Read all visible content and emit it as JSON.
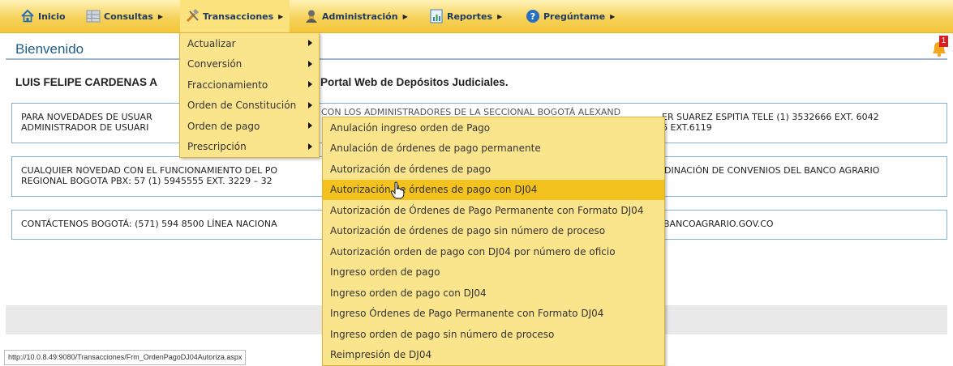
{
  "menu": {
    "items": [
      {
        "label": "Inicio",
        "icon": "home-icon",
        "has_submenu": false
      },
      {
        "label": "Consultas",
        "icon": "grid-icon",
        "has_submenu": true
      },
      {
        "label": "Transacciones",
        "icon": "tools-icon",
        "has_submenu": true
      },
      {
        "label": "Administración",
        "icon": "user-icon",
        "has_submenu": true
      },
      {
        "label": "Reportes",
        "icon": "report-icon",
        "has_submenu": true
      },
      {
        "label": "Pregúntame",
        "icon": "help-icon",
        "has_submenu": true
      }
    ]
  },
  "header": {
    "welcome": "Bienvenido",
    "notifications_count": "1",
    "user_name": "LUIS FELIPE CARDENAS A",
    "portal_text": "Portal Web de Depósitos Judiciales."
  },
  "info_boxes": [
    {
      "line1": "PARA NOVEDADES DE USUAR",
      "line2": "ADMINISTRADOR DE USUARI",
      "right1": "ER SUAREZ ESPITIA TELE (1) 3532666 EXT. 6042",
      "right2": "6 EXT.6119",
      "overlap": "CON LOS ADMINISTRADORES DE LA SECCIONAL BOGOTÁ ALEXAND"
    },
    {
      "line1": "CUALQUIER NOVEDAD CON EL FUNCIONAMIENTO DEL PO",
      "line2": "REGIONAL BOGOTA PBX: 57 (1) 5945555 EXT. 3229 – 32",
      "right1": "DINACIÓN DE CONVENIOS DEL BANCO AGRARIO",
      "right2": ""
    },
    {
      "line1": "CONTÁCTENOS BOGOTÁ: (571) 594 8500 LÍNEA NACIONA",
      "line2": "",
      "right1": "BANCOAGRARIO.GOV.CO",
      "right2": ""
    }
  ],
  "transacciones_menu": [
    {
      "label": "Actualizar",
      "submenu": true
    },
    {
      "label": "Conversión",
      "submenu": true
    },
    {
      "label": "Fraccionamiento",
      "submenu": true
    },
    {
      "label": "Orden de Constitución",
      "submenu": true
    },
    {
      "label": "Orden de pago",
      "submenu": true
    },
    {
      "label": "Prescripción",
      "submenu": true
    }
  ],
  "orden_pago_menu": [
    {
      "label": "Anulación ingreso orden de Pago"
    },
    {
      "label": "Anulación de órdenes de pago permanente"
    },
    {
      "label": "Autorización de órdenes de pago"
    },
    {
      "label": "Autorización de órdenes de pago con DJ04",
      "highlighted": true
    },
    {
      "label": "Autorización de Órdenes de Pago Permanente con Formato DJ04"
    },
    {
      "label": "Autorización de órdenes de pago sin número de proceso"
    },
    {
      "label": "Autorización orden de pago con DJ04 por número de oficio"
    },
    {
      "label": "Ingreso orden de pago"
    },
    {
      "label": "Ingreso orden de pago con DJ04"
    },
    {
      "label": "Ingreso Órdenes de Pago Permanente con Formato DJ04"
    },
    {
      "label": "Ingreso orden de pago sin número de proceso"
    },
    {
      "label": "Reimpresión de DJ04"
    }
  ],
  "status_bar": {
    "url": "http://10.0.8.49:9080/Transacciones/Frm_OrdenPagoDJ04Autoriza.aspx"
  },
  "colors": {
    "menu_bar": "#f6d25b",
    "dropdown_bg": "#fbe58c",
    "highlight": "#f3c21f",
    "title_blue": "#1e5e8c",
    "box_border": "#7fb2d6"
  }
}
